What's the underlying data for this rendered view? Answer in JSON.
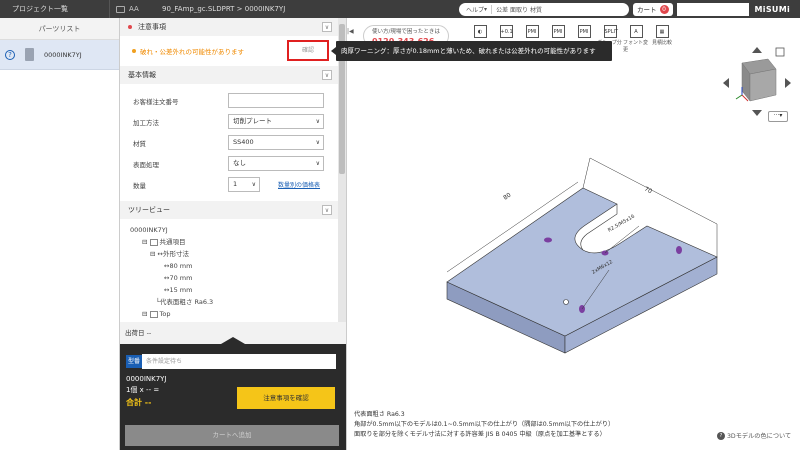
{
  "topbar": {
    "project_list": "プロジェクト一覧",
    "folder": "AA",
    "breadcrumb": "90_FAmp_gc.SLDPRT > 0000INK7YJ",
    "help": "ヘルプ",
    "links": [
      "公差",
      "面取り",
      "材質"
    ],
    "cart_label": "カート",
    "cart_count": "0",
    "logo": "MiSUMi"
  },
  "parts": {
    "header": "パーツリスト",
    "items": [
      {
        "name": "0000INK7YJ"
      }
    ]
  },
  "notice": {
    "header": "注意事項",
    "warning": "破れ・公差外れの可能性があります",
    "confirm": "確認"
  },
  "basic": {
    "header": "基本情報",
    "fields": [
      {
        "label": "お客様注文番号",
        "value": ""
      },
      {
        "label": "加工方法",
        "value": "切削プレート"
      },
      {
        "label": "材質",
        "value": "SS400"
      },
      {
        "label": "表面処理",
        "value": "なし"
      },
      {
        "label": "数量",
        "value": "1"
      }
    ],
    "qty_link": "数量別の価格表"
  },
  "tree": {
    "header": "ツリービュー",
    "root": "0000INK7YJ",
    "items": [
      "共通項目",
      "外形寸法",
      "80 mm",
      "70 mm",
      "15 mm",
      "代表面粗さ Ra6.3",
      "Top"
    ]
  },
  "ship": "出荷日 --",
  "order": {
    "tag": "型番",
    "cond_placeholder": "条件設定待ち",
    "part_no": "0000INK7YJ",
    "qty_line": "1個 x -- =",
    "total": "合計 --",
    "confirm_btn": "注意事項を確認",
    "cart_btn": "カートへ追加"
  },
  "tooltip": "肉厚ワーニング：厚さが0.18mmと薄いため、破れまたは公差外れの可能性があります",
  "phone": {
    "line1": "使い方/現場で困ったときは",
    "number": "0120-343-626"
  },
  "tools": [
    {
      "glyph": "◐",
      "label": ""
    },
    {
      "glyph": "+0.1",
      "label": ""
    },
    {
      "glyph": "PMI",
      "label": ""
    },
    {
      "glyph": "PMI",
      "label": ""
    },
    {
      "glyph": "PMI",
      "label": ""
    },
    {
      "glyph": "SPLIT",
      "label": "グループ分解"
    },
    {
      "glyph": "A",
      "label": "フォント変更"
    },
    {
      "glyph": "▦",
      "label": "見積比較"
    }
  ],
  "dims": {
    "d1": "80",
    "d2": "70",
    "d3": "R2.5/M5x16",
    "d4": "2xM6x12"
  },
  "note_lines": [
    "代表面粗さ Ra6.3",
    "角部が0.5mm以下のモデルは0.1~0.5mm以下の仕上がり（隅部は0.5mm以下の仕上がり）",
    "面取りを部分を除くモデル寸法に対する許容差 JIS B 0405 中級（原点を加工基準とする）"
  ],
  "color_help": "3Dモデルの色について",
  "colors": {
    "accent": "#1a5fb4",
    "warning": "#f08a00",
    "model": "#b0bedc",
    "hole": "#7b3fa0"
  }
}
